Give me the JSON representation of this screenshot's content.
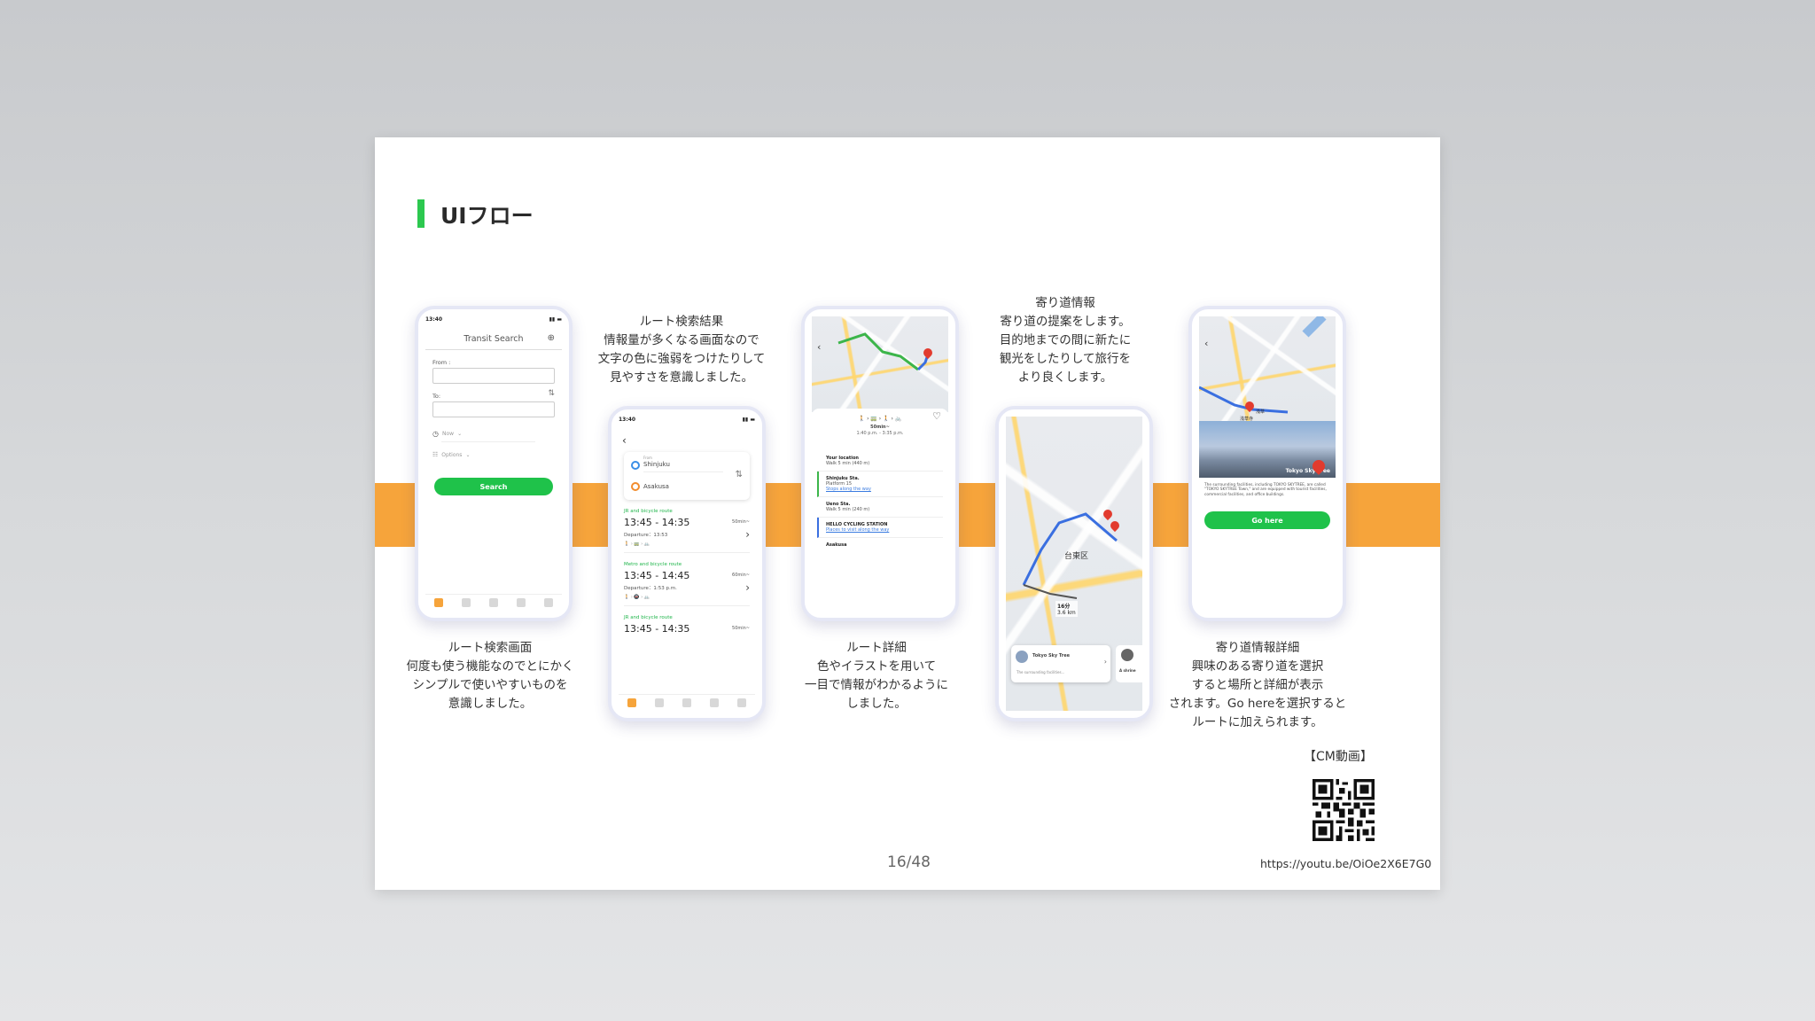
{
  "slide": {
    "title": "UIフロー",
    "page_number": "16/48",
    "cm_label": "【CM動画】",
    "url": "https://youtu.be/OiOe2X6E7G0"
  },
  "captions": {
    "search": [
      "ルート検索画面",
      "何度も使う機能なのでとにかく",
      "シンプルで使いやすいものを",
      "意識しました。"
    ],
    "results": [
      "ルート検索結果",
      "情報量が多くなる画面なので",
      "文字の色に強弱をつけたりして",
      "見やすさを意識しました。"
    ],
    "detail": [
      "ルート詳細",
      "色やイラストを用いて",
      "一目で情報がわかるように",
      "しました。"
    ],
    "stopover": [
      "寄り道情報",
      "寄り道の提案をします。",
      "目的地までの間に新たに",
      "観光をしたりして旅行を",
      "より良くします。"
    ],
    "stopover_detail": [
      "寄り道情報詳細",
      "興味のある寄り道を選択",
      "すると場所と詳細が表示",
      "されます。Go hereを選択すると",
      "ルートに加えられます。"
    ]
  },
  "phone1": {
    "time": "13:40",
    "header": "Transit Search",
    "from_label": "From :",
    "to_label": "To:",
    "now_label": "Now",
    "options_label": "Options",
    "search_button": "Search"
  },
  "phone2": {
    "time": "13:40",
    "from_caption": "From",
    "from": "Shinjuku",
    "to": "Asakusa",
    "routes": [
      {
        "tag": "JR and bicycle route",
        "time": "13:45 - 14:35",
        "duration": "50min~",
        "departure": "Departure：13:53"
      },
      {
        "tag": "Metro and bicycle route",
        "time": "13:45 - 14:45",
        "duration": "60min~",
        "departure": "Departure：1:53 p.m."
      },
      {
        "tag": "JR and bicycle route",
        "time": "13:45 - 14:35",
        "duration": "50min~",
        "departure": ""
      }
    ]
  },
  "phone3": {
    "summary": "50min~",
    "times": "1:40 p.m. - 3:35 p.m.",
    "items": [
      {
        "title": "Your location",
        "sub": "Walk 5 min (440 m)"
      },
      {
        "title": "Shinjuku Sta.",
        "sub": "Platform 15",
        "link": "Stops along the way"
      },
      {
        "title": "Ueno Sta.",
        "sub": "Walk 5 min (240 m)"
      },
      {
        "title": "HELLO CYCLING STATION",
        "sub": "",
        "link": "Places to visit along the way"
      },
      {
        "title": "Asakusa",
        "sub": ""
      }
    ]
  },
  "phone4": {
    "district": "台東区",
    "minutes": "16分",
    "distance": "3.6 km",
    "card_title": "Tokyo Sky Tree",
    "card_sub": "The surrounding facilities...",
    "side_card": "A shrine"
  },
  "phone5": {
    "spot_label": "Tokyo Sky Tree",
    "place1": "浅草",
    "place2": "浅草寺",
    "description": "The surrounding facilities, including TOKYO SKYTREE, are called \"TOKYO SKYTREE Town,\" and are equipped with tourist facilities, commercial facilities, and office buildings.",
    "go_button": "Go here"
  }
}
